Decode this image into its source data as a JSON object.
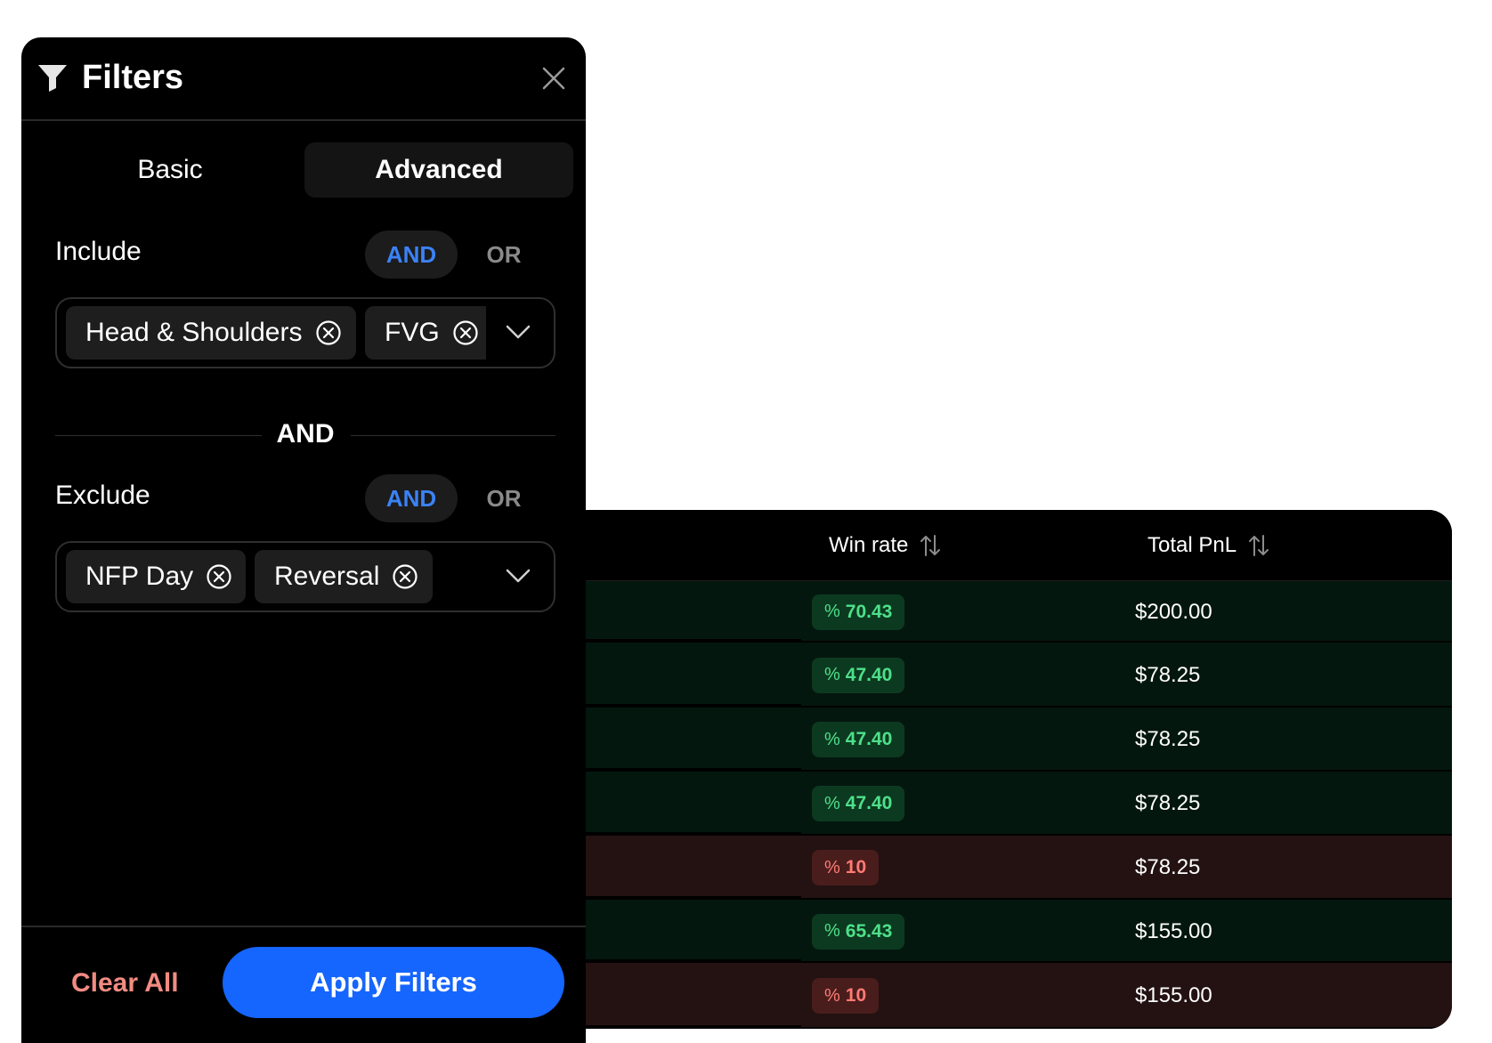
{
  "filters": {
    "title": "Filters",
    "tabs": [
      {
        "label": "Basic",
        "active": false
      },
      {
        "label": "Advanced",
        "active": true
      }
    ],
    "include": {
      "label": "Include",
      "and_label": "AND",
      "or_label": "OR",
      "selected": "AND",
      "chips": [
        "Head & Shoulders",
        "FVG"
      ]
    },
    "joiner": "AND",
    "exclude": {
      "label": "Exclude",
      "and_label": "AND",
      "or_label": "OR",
      "selected": "AND",
      "chips": [
        "NFP Day",
        "Reversal"
      ]
    },
    "clear_label": "Clear All",
    "apply_label": "Apply Filters"
  },
  "table": {
    "columns": [
      "Win rate",
      "Total PnL"
    ],
    "percent_symbol": "%",
    "rows": [
      {
        "win_rate": "70.43",
        "pnl": "$200.00",
        "status": "positive"
      },
      {
        "win_rate": "47.40",
        "pnl": "$78.25",
        "status": "positive"
      },
      {
        "win_rate": "47.40",
        "pnl": "$78.25",
        "status": "positive"
      },
      {
        "win_rate": "47.40",
        "pnl": "$78.25",
        "status": "positive"
      },
      {
        "win_rate": "10",
        "pnl": "$78.25",
        "status": "negative"
      },
      {
        "win_rate": "65.43",
        "pnl": "$155.00",
        "status": "positive"
      },
      {
        "win_rate": "10",
        "pnl": "$155.00",
        "status": "negative"
      }
    ]
  },
  "colors": {
    "accent": "#1565ff",
    "toggle_active": "#3b82f6",
    "positive_text": "#4ee08a",
    "negative_text": "#ff7b72",
    "clear_text": "#f28b82"
  }
}
